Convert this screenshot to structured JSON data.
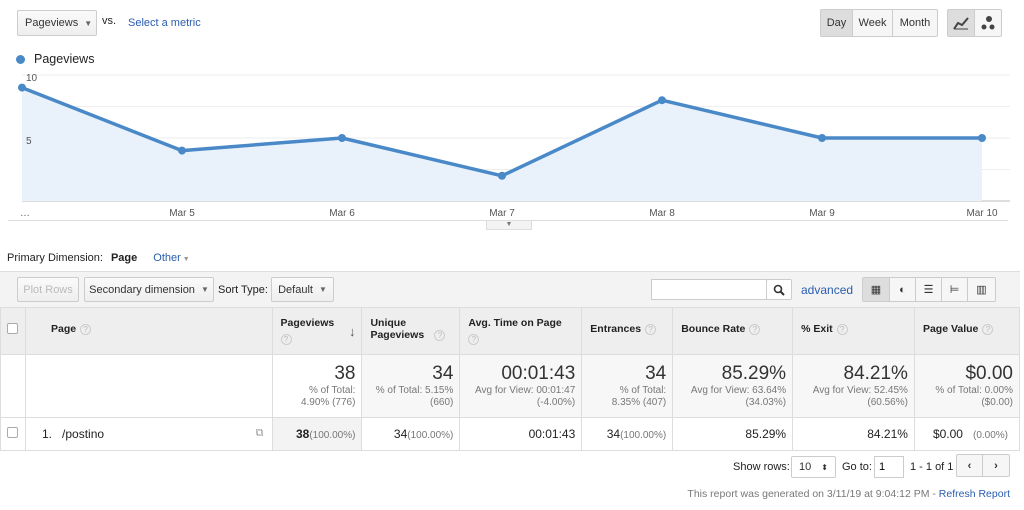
{
  "top": {
    "metric_select": "Pageviews",
    "vs": "vs.",
    "select_metric": "Select a metric",
    "periods": [
      "Day",
      "Week",
      "Month"
    ],
    "active_period": "Day",
    "chart_modes": [
      "line-chart-icon",
      "motion-chart-icon"
    ]
  },
  "chart_data": {
    "type": "area",
    "legend": "Pageviews",
    "series_color": "#4a89c8",
    "categories": [
      "…",
      "Mar 5",
      "Mar 6",
      "Mar 7",
      "Mar 8",
      "Mar 9",
      "Mar 10"
    ],
    "series": [
      {
        "name": "Pageviews",
        "values": [
          9,
          4,
          5,
          2,
          8,
          5,
          5
        ]
      }
    ],
    "yticks": [
      "10",
      "5"
    ],
    "ylim": [
      0,
      10
    ],
    "grid": true
  },
  "dimension": {
    "label": "Primary Dimension:",
    "active": "Page",
    "other": "Other"
  },
  "toolbar": {
    "plot_rows": "Plot Rows",
    "secondary": "Secondary dimension",
    "sort_label": "Sort Type:",
    "sort_value": "Default",
    "search_placeholder": "",
    "advanced": "advanced",
    "views": [
      "table-icon",
      "pie-icon",
      "bar-icon",
      "comparison-icon",
      "pivot-icon"
    ]
  },
  "table": {
    "headers": [
      {
        "label": "Page"
      },
      {
        "label": "Pageviews"
      },
      {
        "label": "Unique Pageviews"
      },
      {
        "label": "Avg. Time on Page"
      },
      {
        "label": "Entrances"
      },
      {
        "label": "Bounce Rate"
      },
      {
        "label": "% Exit"
      },
      {
        "label": "Page Value"
      }
    ],
    "totals": [
      {
        "value": "38",
        "l1": "% of Total:",
        "l2": "4.90% (776)"
      },
      {
        "value": "34",
        "l1": "% of Total: 5.15%",
        "l2": "(660)"
      },
      {
        "value": "00:01:43",
        "l1": "Avg for View: 00:01:47",
        "l2": "(-4.00%)"
      },
      {
        "value": "34",
        "l1": "% of Total:",
        "l2": "8.35% (407)"
      },
      {
        "value": "85.29%",
        "l1": "Avg for View: 63.64%",
        "l2": "(34.03%)"
      },
      {
        "value": "84.21%",
        "l1": "Avg for View: 52.45%",
        "l2": "(60.56%)"
      },
      {
        "value": "$0.00",
        "l1": "% of Total: 0.00%",
        "l2": "($0.00)"
      }
    ],
    "rows": [
      {
        "index": "1.",
        "page": "/postino",
        "pageviews": "38",
        "pageviews_pct": "(100.00%)",
        "unique": "34",
        "unique_pct": "(100.00%)",
        "avg_time": "00:01:43",
        "entrances": "34",
        "entrances_pct": "(100.00%)",
        "bounce": "85.29%",
        "exit": "84.21%",
        "value": "$0.00",
        "value_pct": "(0.00%)"
      }
    ]
  },
  "footer": {
    "show_rows_label": "Show rows:",
    "show_rows": "10",
    "goto_label": "Go to:",
    "goto": "1",
    "range": "1 - 1 of 1",
    "generated": "This report was generated on 3/11/19 at 9:04:12 PM - ",
    "refresh": "Refresh Report"
  }
}
